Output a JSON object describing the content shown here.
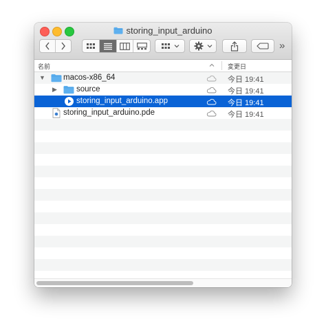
{
  "window": {
    "title": "storing_input_arduino"
  },
  "toolbar": {
    "back_icon": "chevron-left-icon",
    "forward_icon": "chevron-right-icon",
    "view_modes": [
      "icon-view",
      "list-view",
      "column-view",
      "gallery-view"
    ],
    "active_view": "list-view",
    "group_icon": "group-by-icon",
    "action_icon": "gear-icon",
    "share_icon": "share-icon",
    "tag_icon": "tag-icon",
    "overflow_label": "»"
  },
  "columns": {
    "name": "名前",
    "date": "変更日"
  },
  "files": [
    {
      "name": "macos-x86_64",
      "date": "今日 19:41",
      "kind": "folder",
      "expanded": true,
      "indent": 0,
      "selected": false
    },
    {
      "name": "source",
      "date": "今日 19:41",
      "kind": "folder",
      "expanded": false,
      "indent": 1,
      "selected": false
    },
    {
      "name": "storing_input_arduino.app",
      "date": "今日 19:41",
      "kind": "app",
      "indent": 1,
      "selected": true
    },
    {
      "name": "storing_input_arduino.pde",
      "date": "今日 19:41",
      "kind": "document",
      "indent": 0,
      "selected": false
    }
  ],
  "colors": {
    "selection": "#0a63d6",
    "folder": "#5eb0ef",
    "stripe": "#f4f5f5"
  }
}
